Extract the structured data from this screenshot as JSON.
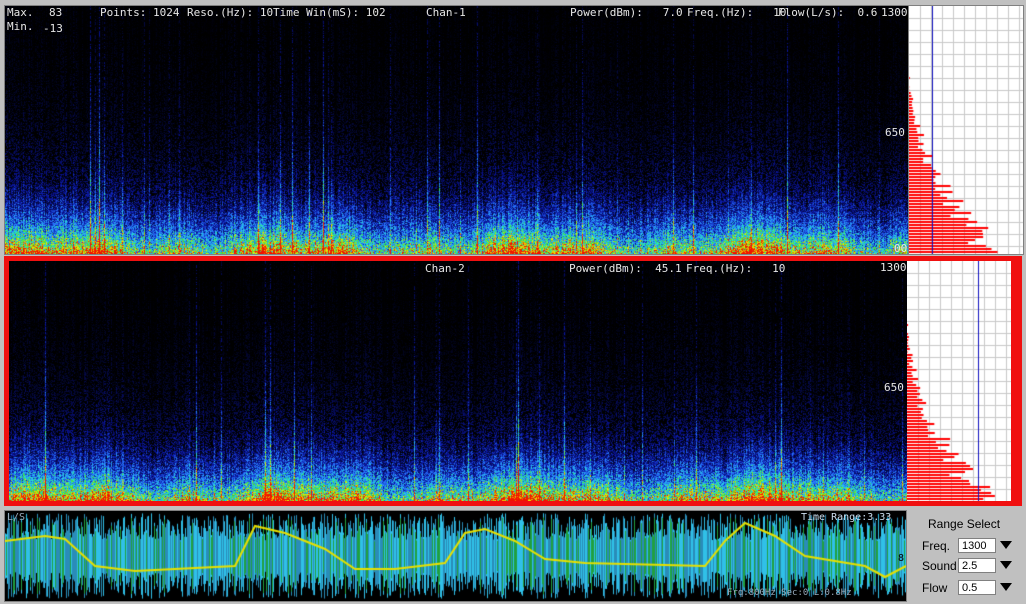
{
  "chan1": {
    "max_label": "Max.",
    "max_value": "83",
    "min_label": "Min.",
    "min_value": "-13",
    "points": "Points: 1024",
    "reso": "Reso.(Hz): 10",
    "time_win": "Time Win(mS): 102",
    "title": "Chan-1",
    "power": "Power(dBm):   7.0",
    "freq": "Freq.(Hz):   10",
    "flow": "Flow(L/s):  0.6",
    "ytop": "1300",
    "ymid": "650",
    "ybot": "00"
  },
  "chan2": {
    "title": "Chan-2",
    "power": "Power(dBm):  45.1",
    "freq": "Freq.(Hz):   10",
    "ytop": "1300",
    "ymid": "650"
  },
  "wave": {
    "left_label": "L/S",
    "time_range": "Time Range:3.33",
    "bottom_text": "Frq:800Hz Sec:0 L:0.8Hz",
    "right_marker": "8"
  },
  "range_select": {
    "title": "Range Select",
    "freq_label": "Freq.",
    "freq_value": "1300",
    "sound_label": "Sound",
    "sound_value": "2.5",
    "flow_label": "Flow",
    "flow_value": "0.5"
  },
  "colors": {
    "accent_border": "#f01010",
    "hist_bar": "#ff0000",
    "hist_line": "#1010c0",
    "wave_fill": "#30c0e8",
    "flow_line": "#e8e000"
  }
}
